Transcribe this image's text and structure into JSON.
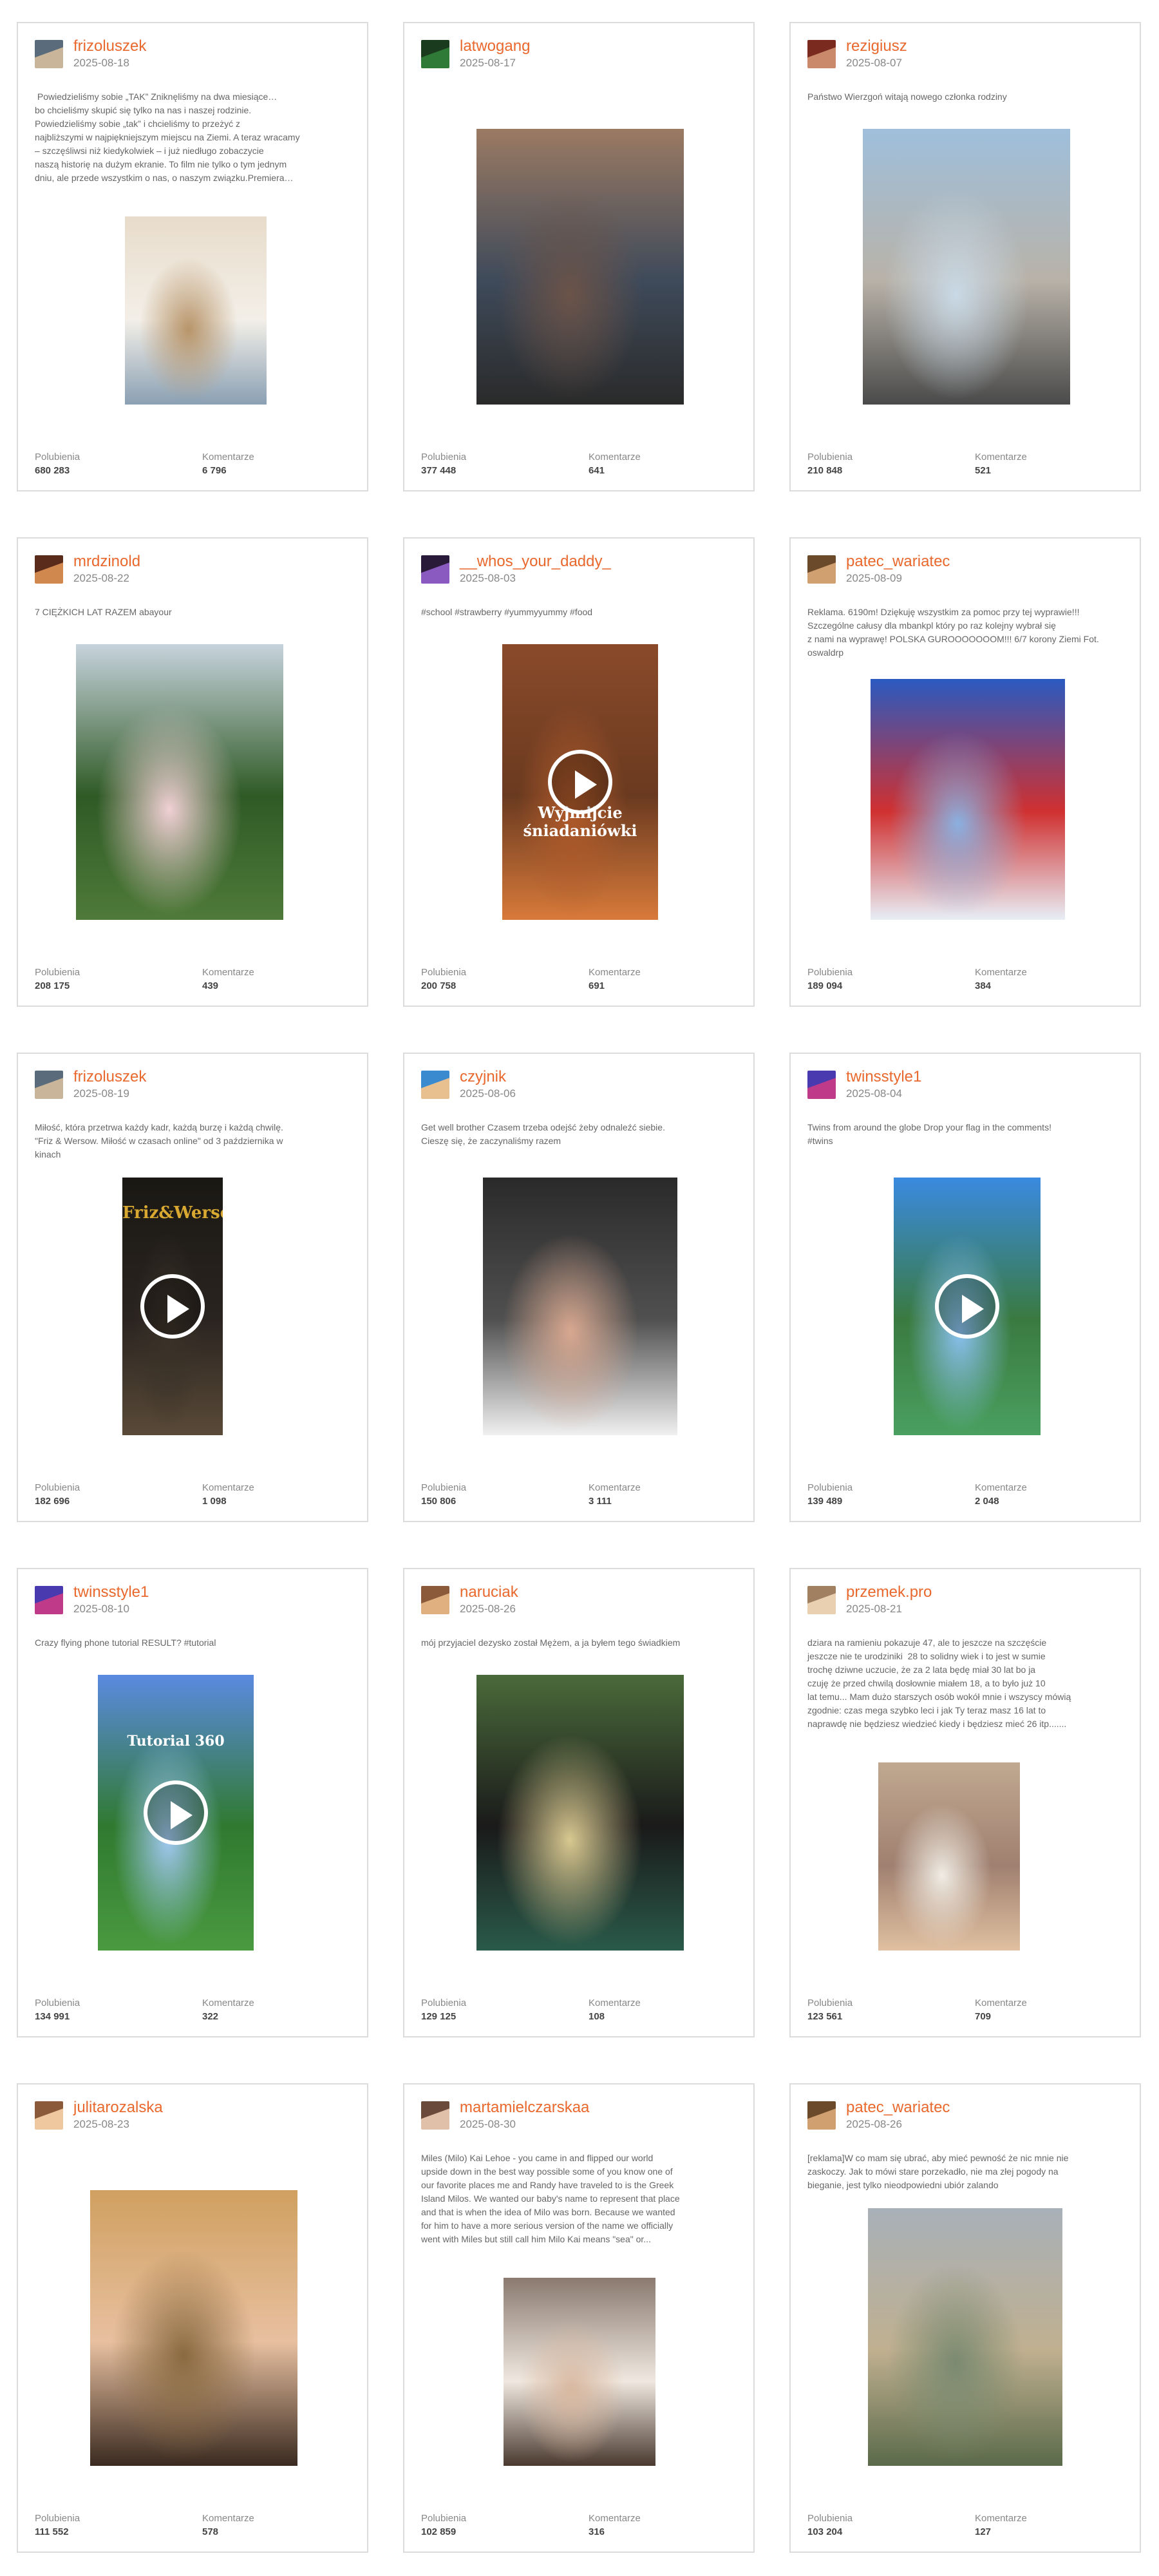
{
  "labels": {
    "likes": "Polubienia",
    "comments": "Komentarze"
  },
  "posts": [
    {
      "username": "frizoluszek",
      "date": "2025-08-18",
      "caption": " Powiedzieliśmy sobie „TAK” Zniknęliśmy na dwa miesiące…\nbo chcieliśmy skupić się tylko na nas i naszej rodzinie.\nPowiedzieliśmy sobie „tak” i chcieliśmy to przeżyć z\nnajbliższymi w najpiękniejszym miejscu na Ziemi. A teraz wracamy\n– szczęśliwsi niż kiedykolwiek – i już niedługo zobaczycie\nnaszą historię na dużym ekranie. To film nie tylko o tym jednym\ndniu, ale przede wszystkim o nas, o naszym związku.Premiera…",
      "likes": "680 283",
      "comments": "6 796",
      "avatar_colors": [
        "#5a6b7c",
        "#c9b69a"
      ],
      "image_colors": [
        "#e8dccb",
        "#b8956a",
        "#8aa0b3",
        "#f3efe8"
      ],
      "video": false,
      "overlay": ""
    },
    {
      "username": "latwogang",
      "date": "2025-08-17",
      "caption": "",
      "likes": "377 448",
      "comments": "641",
      "avatar_colors": [
        "#1b3b1e",
        "#2f7a36"
      ],
      "image_colors": [
        "#9b7a63",
        "#6b5348",
        "#2a2a2a",
        "#3e4a5a"
      ],
      "video": false,
      "overlay": ""
    },
    {
      "username": "rezigiusz",
      "date": "2025-08-07",
      "caption": "Państwo Wierzgoń witają nowego członka rodziny",
      "likes": "210 848",
      "comments": "521",
      "avatar_colors": [
        "#7a2a1e",
        "#c9896a"
      ],
      "image_colors": [
        "#9fbfdb",
        "#c9d9e6",
        "#4a4a4a",
        "#b8b2a8"
      ],
      "video": false,
      "overlay": ""
    },
    {
      "username": "mrdzinold",
      "date": "2025-08-22",
      "caption": "7 CIĘŻKICH LAT RAZEM abayour",
      "likes": "208 175",
      "comments": "439",
      "avatar_colors": [
        "#5a2a1a",
        "#d0884f"
      ],
      "image_colors": [
        "#c7d3dd",
        "#f0d0d4",
        "#4f7a3a",
        "#2f5a25"
      ],
      "video": false,
      "overlay": ""
    },
    {
      "username": "__whos_your_daddy_",
      "date": "2025-08-03",
      "caption": "#school #strawberry #yummyyummy #food",
      "likes": "200 758",
      "comments": "691",
      "avatar_colors": [
        "#2a1a3a",
        "#8a5ac0"
      ],
      "image_colors": [
        "#8a4a2a",
        "#b05a2a",
        "#d87a3a",
        "#6a3a20"
      ],
      "video": true,
      "overlay": "Wyjmijcie\nśniadaniówki"
    },
    {
      "username": "patec_wariatec",
      "date": "2025-08-09",
      "caption": "Reklama. 6190m! Dziękuję wszystkim za pomoc przy tej wyprawie!!!\nSzczególne całusy dla mbankpl który po raz kolejny wybrał się\nz nami na wyprawę! POLSKA GUROOOOOOOM!!! 6/7 korony Ziemi Fot.\noswaldrp",
      "likes": "189 094",
      "comments": "384",
      "avatar_colors": [
        "#6a4a2a",
        "#d0a070"
      ],
      "image_colors": [
        "#2a5ac0",
        "#8ab0e0",
        "#e8eef5",
        "#d03030"
      ],
      "video": false,
      "overlay": ""
    },
    {
      "username": "frizoluszek",
      "date": "2025-08-19",
      "caption": "Miłość, która przetrwa każdy kadr, każdą burzę i każdą chwilę.\n\"Friz & Wersow. Miłość w czasach online\" od 3 października w\nkinach",
      "likes": "182 696",
      "comments": "1 098",
      "avatar_colors": [
        "#5a6b7c",
        "#c9b69a"
      ],
      "image_colors": [
        "#1a1814",
        "#3a3228",
        "#5a4a38",
        "#2a2420"
      ],
      "video": true,
      "overlay": "Friz&Wersow"
    },
    {
      "username": "czyjnik",
      "date": "2025-08-06",
      "caption": "Get well brother Czasem trzeba odejść żeby odnaleźć siebie.\nCieszę się, że zaczynaliśmy razem",
      "likes": "150 806",
      "comments": "3 111",
      "avatar_colors": [
        "#3a8ad0",
        "#e8c090"
      ],
      "image_colors": [
        "#2a2a2a",
        "#d8a890",
        "#f0f0f0",
        "#505050"
      ],
      "video": false,
      "overlay": ""
    },
    {
      "username": "twinsstyle1",
      "date": "2025-08-04",
      "caption": "Twins from around the globe Drop your flag in the comments!\n#twins",
      "likes": "139 489",
      "comments": "2 048",
      "avatar_colors": [
        "#4a3ab0",
        "#c03a8a"
      ],
      "image_colors": [
        "#3a8ae0",
        "#8ac0f0",
        "#4aa060",
        "#3a7a40"
      ],
      "video": true,
      "overlay": ""
    },
    {
      "username": "twinsstyle1",
      "date": "2025-08-10",
      "caption": "Crazy flying phone tutorial RESULT? #tutorial",
      "likes": "134 991",
      "comments": "322",
      "avatar_colors": [
        "#4a3ab0",
        "#c03a8a"
      ],
      "image_colors": [
        "#5a8ae0",
        "#a0c8f0",
        "#4a9a40",
        "#2f7a30"
      ],
      "video": true,
      "overlay": "Tutorial 360"
    },
    {
      "username": "naruciak",
      "date": "2025-08-26",
      "caption": "mój przyjaciel dezysko został Mężem, a ja byłem tego świadkiem",
      "likes": "129 125",
      "comments": "108",
      "avatar_colors": [
        "#8a5a3a",
        "#e0b080"
      ],
      "image_colors": [
        "#4a6a3a",
        "#d8c890",
        "#2a5a4a",
        "#1a1a1a"
      ],
      "video": false,
      "overlay": ""
    },
    {
      "username": "przemek.pro",
      "date": "2025-08-21",
      "caption": "dziara na ramieniu pokazuje 47, ale to jeszcze na szczęście\njeszcze nie te urodziniki  28 to solidny wiek i to jest w sumie\ntrochę dziwne uczucie, że za 2 lata będę miał 30 lat bo ja\nczuję że przed chwilą dosłownie miałem 18, a to było już 10\nlat temu... Mam dużo starszych osób wokół mnie i wszyscy mówią\nzgodnie: czas mega szybko leci i jak Ty teraz masz 16 lat to\nnaprawdę nie będziesz wiedzieć kiedy i będziesz mieć 26 itp.......",
      "likes": "123 561",
      "comments": "709",
      "avatar_colors": [
        "#a08060",
        "#e8d0b0"
      ],
      "image_colors": [
        "#c0a890",
        "#f0ece4",
        "#e0c0a0",
        "#a08070"
      ],
      "video": false,
      "overlay": ""
    },
    {
      "username": "julitarozalska",
      "date": "2025-08-23",
      "caption": "",
      "likes": "111 552",
      "comments": "578",
      "avatar_colors": [
        "#8a5a3a",
        "#f0c8a0"
      ],
      "image_colors": [
        "#d0a060",
        "#8a6a40",
        "#3a2a20",
        "#e8c0a0"
      ],
      "video": false,
      "overlay": ""
    },
    {
      "username": "martamielczarskaa",
      "date": "2025-08-30",
      "caption": "Miles (Milo) Kai Lehoe - you came in and flipped our world\nupside down in the best way possible some of you know one of\nour favorite places me and Randy have traveled to is the Greek\nIsland Milos. We wanted our baby's name to represent that place\nand that is when the idea of Milo was born. Because we wanted\nfor him to have a more serious version of the name we officially\nwent with Miles but still call him Milo Kai means \"sea\" or...",
      "likes": "102 859",
      "comments": "316",
      "avatar_colors": [
        "#6a4a3a",
        "#e0c0a8"
      ],
      "image_colors": [
        "#8a7a70",
        "#d8b8a0",
        "#4a3a30",
        "#f0e8e0"
      ],
      "video": false,
      "overlay": ""
    },
    {
      "username": "patec_wariatec",
      "date": "2025-08-26",
      "caption": "[reklama]W co mam się ubrać, aby mieć pewność że nic mnie nie\nzaskoczy. Jak to mówi stare porzekadło, nie ma złej pogody na\nbieganie, jest tylko nieodpowiedni ubiór zalando",
      "likes": "103 204",
      "comments": "127",
      "avatar_colors": [
        "#6a4a2a",
        "#d0a070"
      ],
      "image_colors": [
        "#a8b0b8",
        "#7a8a70",
        "#5a6a4a",
        "#c0b090"
      ],
      "video": false,
      "overlay": ""
    }
  ]
}
